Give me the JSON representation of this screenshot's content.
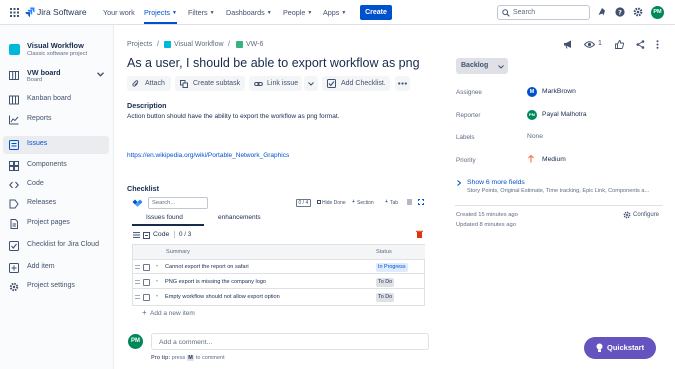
{
  "nav": {
    "logo_text": "Jira Software",
    "items": [
      "Your work",
      "Projects",
      "Filters",
      "Dashboards",
      "People",
      "Apps"
    ],
    "create_label": "Create",
    "search_placeholder": "Search",
    "user_initials": "PM",
    "accent": "#0052cc"
  },
  "sidebar": {
    "project_name": "Visual Workflow",
    "project_type": "Classic software project",
    "board_name": "VW board",
    "board_sub": "Board",
    "items": [
      {
        "label": "Kanban board",
        "icon": "kanban-icon"
      },
      {
        "label": "Reports",
        "icon": "reports-icon"
      },
      {
        "label": "Issues",
        "icon": "issues-icon"
      },
      {
        "label": "Components",
        "icon": "components-icon"
      },
      {
        "label": "Code",
        "icon": "code-icon"
      },
      {
        "label": "Releases",
        "icon": "releases-icon"
      },
      {
        "label": "Project pages",
        "icon": "pages-icon"
      },
      {
        "label": "Checklist for Jira Cloud",
        "icon": "checklist-icon"
      },
      {
        "label": "Add item",
        "icon": "add-item-icon"
      },
      {
        "label": "Project settings",
        "icon": "settings-icon"
      }
    ]
  },
  "breadcrumb": {
    "projects": "Projects",
    "sep": "/",
    "project": "Visual Workflow",
    "issue_key": "VW-6"
  },
  "issue": {
    "title": "As a user, I should be able to export workflow as png",
    "watchers_count": "1",
    "actions": {
      "attach": "Attach",
      "create_subtask": "Create subtask",
      "link_issue": "Link issue",
      "add_checklist": "Add Checklist.",
      "more": "…"
    },
    "description_heading": "Description",
    "description_text": "Action button should have the ability to export the workflow as png format.",
    "description_link": "https://en.wikipedia.org/wiki/Portable_Network_Graphics"
  },
  "checklist": {
    "heading": "Checklist",
    "search_placeholder": "Search...",
    "progress": "0 / 4",
    "hide_done": "Hide Done",
    "section": "Section",
    "tab_btn": "Tab",
    "tabs": [
      "Issues found",
      "enhancements"
    ],
    "section_name": "Code",
    "section_progress": "0 / 3",
    "col_summary": "Summary",
    "col_status": "Status",
    "rows": [
      {
        "summary": "Cannot export the report on safari",
        "status": "In Progress"
      },
      {
        "summary": "PNG export is missing the company logo",
        "status": "To Do"
      },
      {
        "summary": "Empty workflow should not allow export option",
        "status": "To Do"
      }
    ],
    "add_item": "Add a new item"
  },
  "comment": {
    "avatar_initials": "PM",
    "placeholder": "Add a comment...",
    "pro_tip_bold": "Pro tip:",
    "pro_tip_rest": "press",
    "pro_tip_key": "M",
    "pro_tip_end": "to comment"
  },
  "details": {
    "status": "Backlog",
    "assignee_label": "Assignee",
    "assignee": "MarkBrown",
    "assignee_initial": "M",
    "reporter_label": "Reporter",
    "reporter": "Payal Malhotra",
    "reporter_initials": "PM",
    "labels_label": "Labels",
    "labels": "None",
    "priority_label": "Priority",
    "priority": "Medium",
    "more_fields": "Show 6 more fields",
    "more_fields_sub": "Story Points, Original Estimate, Time tracking, Epic Link, Components a...",
    "created": "Created 15 minutes ago",
    "updated": "Updated 8 minutes ago",
    "configure": "Configure"
  },
  "quickstart": "Quickstart"
}
